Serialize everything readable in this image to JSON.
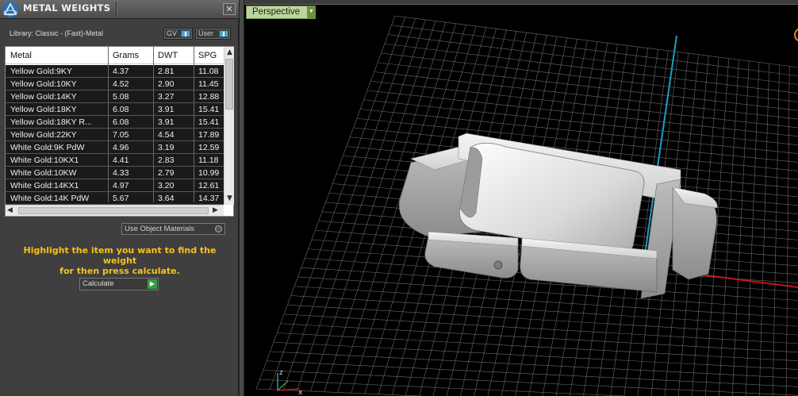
{
  "panel": {
    "title": "METAL WEIGHTS",
    "close_glyph": "✕",
    "library_label": "Library: Classic - (Fast)-Metal",
    "gv_label": "GV",
    "user_label": "User",
    "use_object_materials_label": "Use Object Materials",
    "instructions_line1": "Highlight the item you want to find the weight",
    "instructions_line2": "for then press calculate.",
    "calculate_label": "Calculate"
  },
  "table": {
    "columns": [
      "Metal",
      "Grams",
      "DWT",
      "SPG"
    ],
    "rows": [
      [
        "Yellow Gold:9KY",
        "4.37",
        "2.81",
        "11.08"
      ],
      [
        "Yellow Gold:10KY",
        "4.52",
        "2.90",
        "11.45"
      ],
      [
        "Yellow Gold:14KY",
        "5.08",
        "3.27",
        "12.88"
      ],
      [
        "Yellow Gold:18KY",
        "6.08",
        "3.91",
        "15.41"
      ],
      [
        "Yellow Gold:18KY R...",
        "6.08",
        "3.91",
        "15.41"
      ],
      [
        "Yellow Gold:22KY",
        "7.05",
        "4.54",
        "17.89"
      ],
      [
        "White Gold:9K PdW",
        "4.96",
        "3.19",
        "12.59"
      ],
      [
        "White Gold:10KX1",
        "4.41",
        "2.83",
        "11.18"
      ],
      [
        "White Gold:10KW",
        "4.33",
        "2.79",
        "10.99"
      ],
      [
        "White Gold:14KX1",
        "4.97",
        "3.20",
        "12.61"
      ],
      [
        "White Gold:14K PdW",
        "5.67",
        "3.64",
        "14.37"
      ]
    ]
  },
  "viewport": {
    "view_label": "Perspective",
    "accent_grid": "#6a6a6a",
    "axis_x_color": "#c01818",
    "axis_y_color": "#1aa0c8"
  },
  "icons": {
    "logo": "app-logo-icon",
    "close": "close-icon",
    "dropdown": "chevron-down-icon",
    "play": "play-icon"
  }
}
